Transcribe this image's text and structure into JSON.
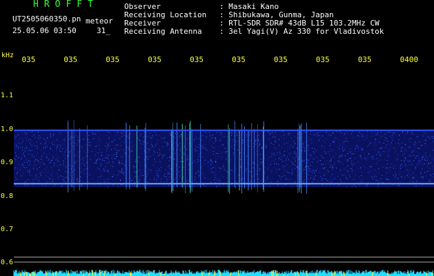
{
  "header": {
    "logo": "HROFFT",
    "filename": "UT2505060350.pn",
    "type": "meteor",
    "datetime": "25.05.06 03:50",
    "count": "31_"
  },
  "info": [
    {
      "label": "Observer",
      "value": ": Masaki Kano"
    },
    {
      "label": "Receiving Location",
      "value": ": Shibukawa, Gunma, Japan"
    },
    {
      "label": "Receiver",
      "value": ": RTL-SDR SDR# 43dB L15 103.2MHz CW"
    },
    {
      "label": "Receiving Antenna",
      "value": ": 3el Yagi(V) Az 330 for Vladivostok"
    }
  ],
  "colors": {
    "text": "#ffffff",
    "logo": "#33ff33",
    "axis": "#ffff44",
    "signal": "#2244ff",
    "baseline": "#22ddff"
  },
  "chart_data": {
    "type": "heatmap",
    "ylabel": "kHz",
    "y_ticks": [
      "1.1",
      "1.0",
      "0.9",
      "0.8",
      "0.7",
      "0.6"
    ],
    "y_tick_values": [
      1.1,
      1.0,
      0.9,
      0.8,
      0.7,
      0.6
    ],
    "ylim": [
      0.58,
      1.2
    ],
    "x_ticks": [
      "035",
      "035",
      "035",
      "035",
      "035",
      "035",
      "035",
      "035",
      "035",
      "0400"
    ],
    "xlim": [
      0,
      10
    ],
    "band_range_khz": [
      0.83,
      1.0
    ],
    "carrier_line_khz": 0.84,
    "meteor_columns": [
      1.52,
      2.9,
      3.9,
      4.2,
      5.3,
      5.8,
      6.75
    ]
  }
}
